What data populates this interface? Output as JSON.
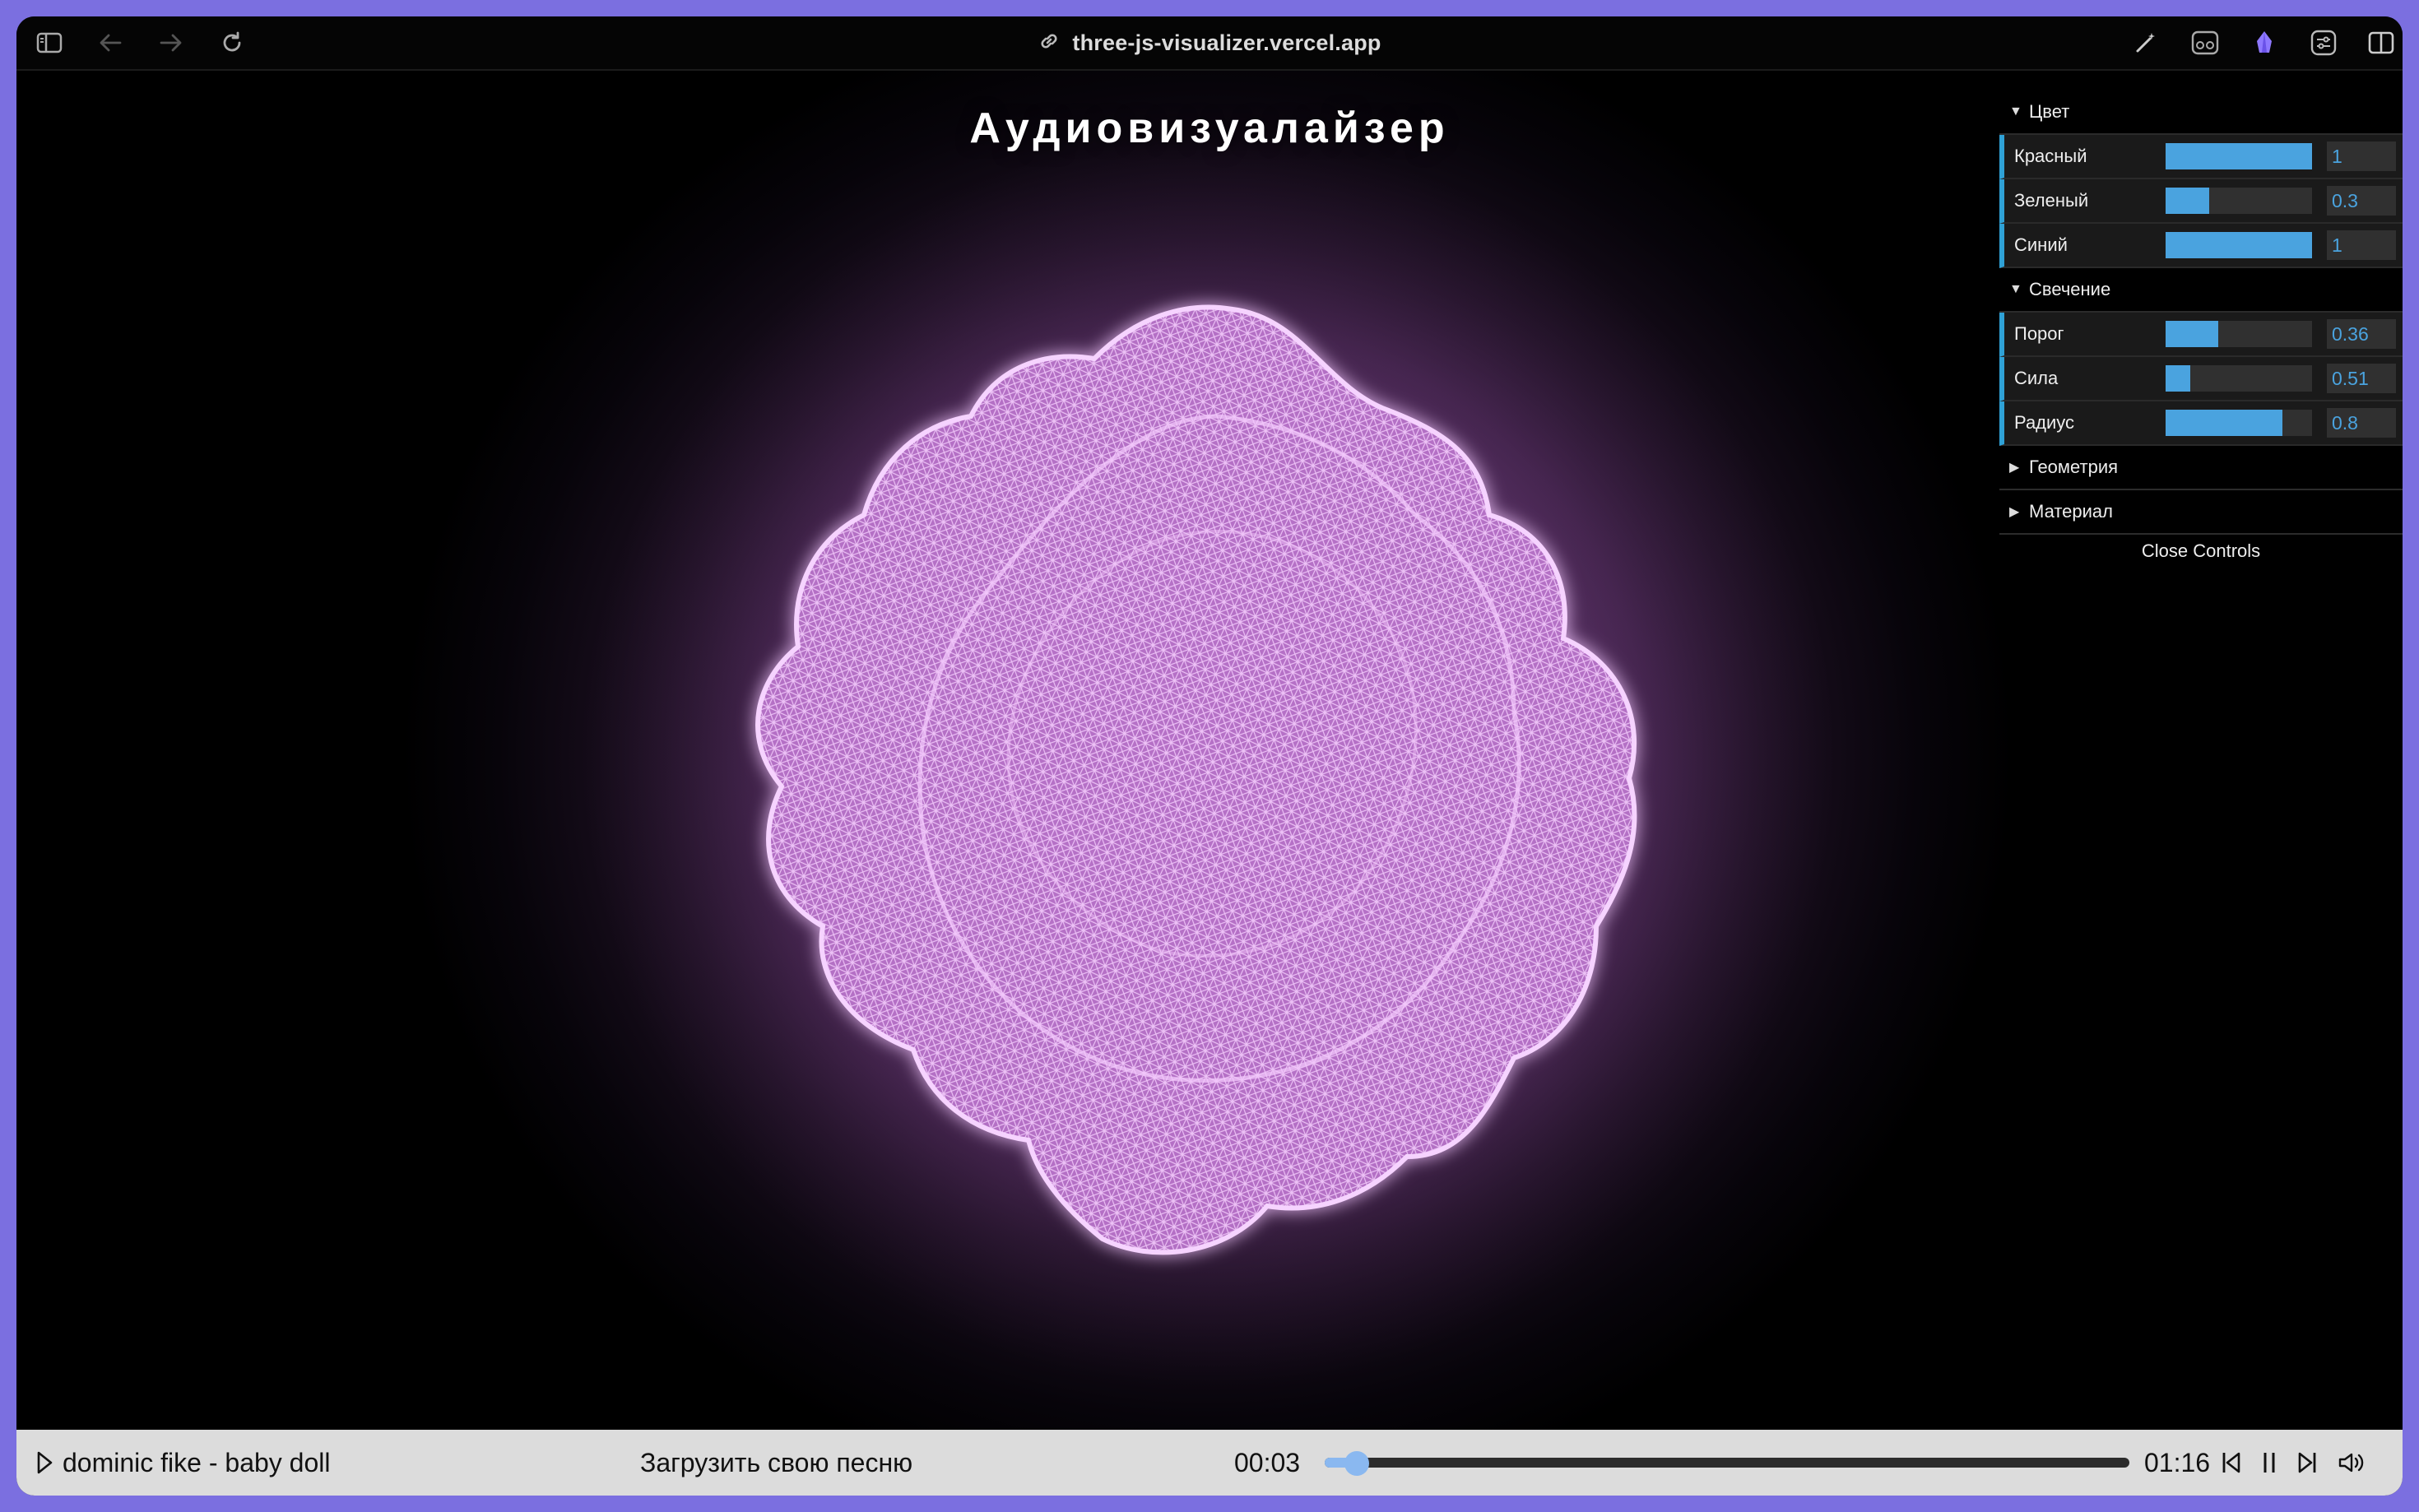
{
  "browser": {
    "address": "three-js-visualizer.vercel.app",
    "icons": [
      "sidebar-icon",
      "back-icon",
      "forward-icon",
      "reload-icon",
      "link-icon",
      "magic-wand-icon",
      "reader-glasses-icon",
      "extension-icon",
      "settings-sliders-icon",
      "split-view-icon"
    ]
  },
  "stage": {
    "title": "Аудиовизуалайзер",
    "accent": "#e8a3f5"
  },
  "gui": {
    "folders": [
      {
        "title": "Цвет",
        "expanded": true,
        "controls": [
          {
            "label": "Красный",
            "value": "1",
            "fraction": 1.0
          },
          {
            "label": "Зеленый",
            "value": "0.3",
            "fraction": 0.3
          },
          {
            "label": "Синий",
            "value": "1",
            "fraction": 1.0
          }
        ]
      },
      {
        "title": "Свечение",
        "expanded": true,
        "controls": [
          {
            "label": "Порог",
            "value": "0.36",
            "fraction": 0.36
          },
          {
            "label": "Сила",
            "value": "0.51",
            "fraction": 0.17
          },
          {
            "label": "Радиус",
            "value": "0.8",
            "fraction": 0.8
          }
        ]
      },
      {
        "title": "Геометрия",
        "expanded": false
      },
      {
        "title": "Материал",
        "expanded": false
      }
    ],
    "close_label": "Close Controls",
    "accent": "#2fa1d6"
  },
  "player": {
    "track_title": "dominic fike - baby doll",
    "upload_label": "Загрузить свою песню",
    "current_time": "00:03",
    "duration": "01:16",
    "progress": 0.04,
    "icons": [
      "play-icon",
      "previous-icon",
      "pause-icon",
      "next-icon",
      "volume-icon"
    ]
  }
}
